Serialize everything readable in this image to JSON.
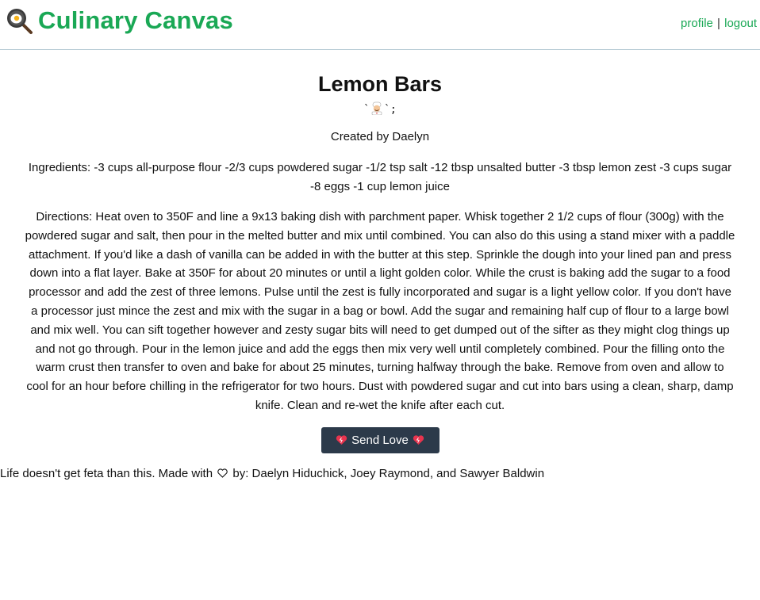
{
  "header": {
    "logo_icon": "frying-pan-egg-icon",
    "title": "Culinary Canvas",
    "links": {
      "profile": "profile",
      "separator": "|",
      "logout": "logout"
    },
    "brand_color": "#1aa855"
  },
  "recipe": {
    "title": "Lemon Bars",
    "emoji_prefix": "`",
    "emoji_icon": "chef-icon",
    "emoji_suffix": "`;",
    "created_by": "Created by Daelyn",
    "ingredients": "Ingredients: -3 cups all-purpose flour -2/3 cups powdered sugar -1/2 tsp salt -12 tbsp unsalted butter -3 tbsp lemon zest -3 cups sugar -8 eggs -1 cup lemon juice",
    "directions": "Directions: Heat oven to 350F and line a 9x13 baking dish with parchment paper. Whisk together 2 1/2 cups of flour (300g) with the powdered sugar and salt, then pour in the melted butter and mix until combined. You can also do this using a stand mixer with a paddle attachment. If you'd like a dash of vanilla can be added in with the butter at this step. Sprinkle the dough into your lined pan and press down into a flat layer. Bake at 350F for about 20 minutes or until a light golden color. While the crust is baking add the sugar to a food processor and add the zest of three lemons. Pulse until the zest is fully incorporated and sugar is a light yellow color. If you don't have a processor just mince the zest and mix with the sugar in a bag or bowl. Add the sugar and remaining half cup of flour to a large bowl and mix well. You can sift together however and zesty sugar bits will need to get dumped out of the sifter as they might clog things up and not go through. Pour in the lemon juice and add the eggs then mix very well until completely combined. Pour the filling onto the warm crust then transfer to oven and bake for about 25 minutes, turning halfway through the bake. Remove from oven and allow to cool for an hour before chilling in the refrigerator for two hours. Dust with powdered sugar and cut into bars using a clean, sharp, damp knife. Clean and re-wet the knife after each cut."
  },
  "actions": {
    "send_love_label": "Send Love",
    "button_color": "#2c3a4a",
    "heart_icon": "heart-icon"
  },
  "footer": {
    "text_before": "Life doesn't get feta than this. Made with",
    "heart_icon": "outline-heart-icon",
    "text_after": "by: Daelyn Hiduchick, Joey Raymond, and Sawyer Baldwin"
  }
}
